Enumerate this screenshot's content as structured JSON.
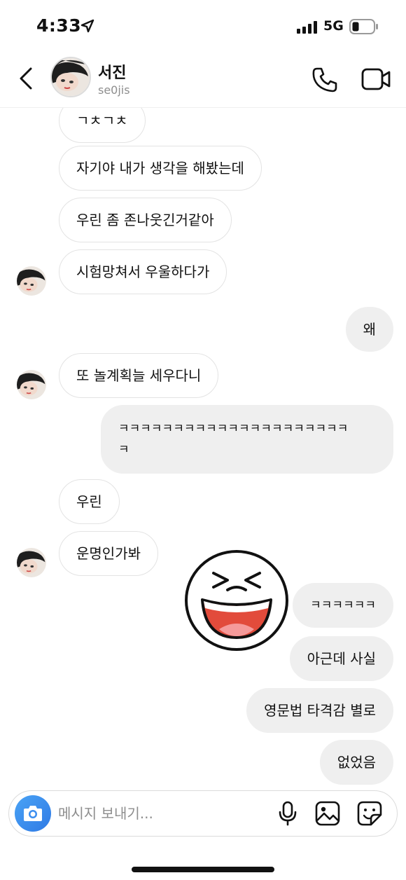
{
  "status_bar": {
    "time": "4:33",
    "network": "5G"
  },
  "header": {
    "name": "서진",
    "username": "se0jis"
  },
  "messages": [
    {
      "side": "in",
      "text": "ㄱㅊㄱㅊ"
    },
    {
      "side": "in",
      "text": "자기야 내가 생각을 해봤는데"
    },
    {
      "side": "in",
      "text": "우린 좀 존나웃긴거같아"
    },
    {
      "side": "in",
      "text": "시험망쳐서 우울하다가"
    },
    {
      "side": "out",
      "text": "왜"
    },
    {
      "side": "in",
      "text": "또 놀계획늘 세우다니"
    },
    {
      "side": "out",
      "line1": "ㅋㅋㅋㅋㅋㅋㅋㅋㅋㅋㅋㅋㅋㅋㅋㅋㅋㅋㅋㅋㅋ",
      "line2": "ㅋ"
    },
    {
      "side": "in",
      "text": "우린"
    },
    {
      "side": "in",
      "text": "운명인가봐"
    },
    {
      "side": "out",
      "text": "ㅋㅋㅋㅋㅋㅋ"
    },
    {
      "side": "out",
      "text": "아근데 사실"
    },
    {
      "side": "out",
      "text": "영문법 타격감 별로"
    },
    {
      "side": "out",
      "text": "없었음"
    }
  ],
  "sticker": {
    "icon": "laughing-face-sticker"
  },
  "composer": {
    "placeholder": "메시지 보내기..."
  },
  "colors": {
    "camera_button": "#3b8ef0",
    "outgoing_bubble": "#efefef",
    "incoming_border": "#e3e3e3"
  }
}
